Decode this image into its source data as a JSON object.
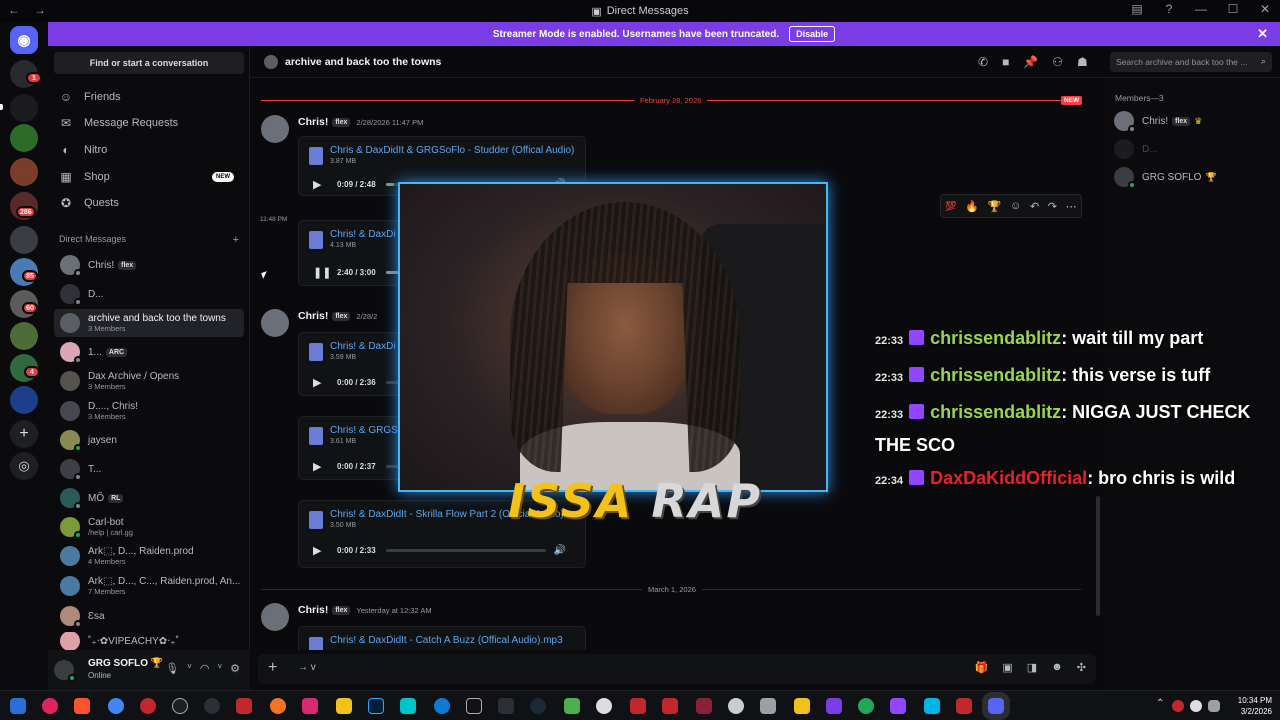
{
  "window": {
    "title": "Direct Messages"
  },
  "banner": {
    "text": "Streamer Mode is enabled. Usernames have been truncated.",
    "button": "Disable"
  },
  "rail": {
    "badges": [
      "1",
      "286",
      "85",
      "60",
      "4"
    ]
  },
  "sidebar": {
    "find": "Find or start a conversation",
    "nav": [
      {
        "label": "Friends",
        "icon": "friends-icon"
      },
      {
        "label": "Message Requests",
        "icon": "mail-icon"
      },
      {
        "label": "Nitro",
        "icon": "nitro-icon"
      },
      {
        "label": "Shop",
        "icon": "shop-icon",
        "tag": "NEW"
      },
      {
        "label": "Quests",
        "icon": "quests-icon"
      }
    ],
    "dm_header": "Direct Messages",
    "dms": [
      {
        "name": "Chris!",
        "tag": "flex"
      },
      {
        "name": "D..."
      },
      {
        "name": "archive and back too the towns",
        "sub": "3 Members"
      },
      {
        "name": "1...",
        "tag": "ARC"
      },
      {
        "name": "Dax Archive / Opens",
        "sub": "3 Members"
      },
      {
        "name": "D...., Chris!",
        "sub": "3 Members"
      },
      {
        "name": "jaysen"
      },
      {
        "name": "T..."
      },
      {
        "name": "MÕ",
        "tag": "RL"
      },
      {
        "name": "Carl-bot",
        "sub": "/help | carl.gg"
      },
      {
        "name": "Ark⬚, D..., Raiden.prod",
        "sub": "4 Members"
      },
      {
        "name": "Ark⬚, D..., C..., Raiden.prod, An...",
        "sub": "7 Members"
      },
      {
        "name": "Ɛsa"
      },
      {
        "name": "⁠˚₊‧✿VIPEACHY✿‧₊˚"
      }
    ]
  },
  "user": {
    "name": "GRG SOFLO",
    "status": "Online"
  },
  "chat": {
    "title": "archive and back too the towns",
    "search_placeholder": "Search archive and back too the ...",
    "date1": "February 28, 2026",
    "new_label": "NEW",
    "date2": "March 1, 2026",
    "side_time": "11:48 PM",
    "messages": [
      {
        "author": "Chris!",
        "tag": "flex",
        "time": "2/28/2026 11:47 PM"
      },
      {
        "author": "Chris!",
        "tag": "flex",
        "time": "2/28/2"
      },
      {
        "author": "Chris!",
        "tag": "flex",
        "time": "Yesterday at 12:32 AM"
      }
    ],
    "attachments": [
      {
        "name": "Chris & DaxDidIt & GRGSoFlo - Studder (Offical Audio)",
        "size": "3.87 MB",
        "time": "0:09 / 2:48",
        "progress": 0.05,
        "playing": false
      },
      {
        "name": "Chris! & DaxDi",
        "size": "4.13 MB",
        "time": "2:40 / 3:00",
        "progress": 0.89,
        "playing": true
      },
      {
        "name": "Chris! & DaxDi",
        "size": "3.59 MB",
        "time": "0:00 / 2:36",
        "progress": 0,
        "playing": false
      },
      {
        "name": "Chris! & GRGSo",
        "size": "3.61 MB",
        "time": "0:00 / 2:37",
        "progress": 0,
        "playing": false
      },
      {
        "name": "Chris! & DaxDidIt - Skrilla Flow Part 2 (Official Audio).mp3",
        "size": "3.50 MB",
        "time": "0:00 / 2:33",
        "progress": 0,
        "playing": false
      },
      {
        "name": "Chris! & DaxDidIt - Catch A Buzz (Offical Audio).mp3"
      }
    ],
    "input_text": "→ v"
  },
  "members": {
    "header": "Members—3",
    "list": [
      {
        "name": "Chris!",
        "tag": "flex"
      },
      {
        "name": "D..."
      },
      {
        "name": "GRG SOFLO"
      }
    ]
  },
  "overlay": {
    "title_word1": "ISSA",
    "title_word2": "RAP",
    "chat": [
      {
        "time": "22:33",
        "user": "chrissendablitz",
        "color": "#9ad64a",
        "text": ": wait till my part"
      },
      {
        "time": "22:33",
        "user": "chrissendablitz",
        "color": "#9ad64a",
        "text": ": this verse is tuff"
      },
      {
        "time": "22:33",
        "user": "chrissendablitz",
        "color": "#9ad64a",
        "text": ": NIGGA JUST CHECK THE SCO"
      },
      {
        "time": "22:34",
        "user": "DaxDaKiddOfficial",
        "color": "#e8222a",
        "text": ": bro chris is wild"
      }
    ]
  },
  "taskbar": {
    "time": "10:34 PM",
    "date": "3/2/2026"
  },
  "colors": {
    "accent": "#5865f2",
    "banner": "#7a3ce4",
    "link": "#5ca6ee",
    "new": "#f23f42",
    "twitch": "#9146ff"
  }
}
